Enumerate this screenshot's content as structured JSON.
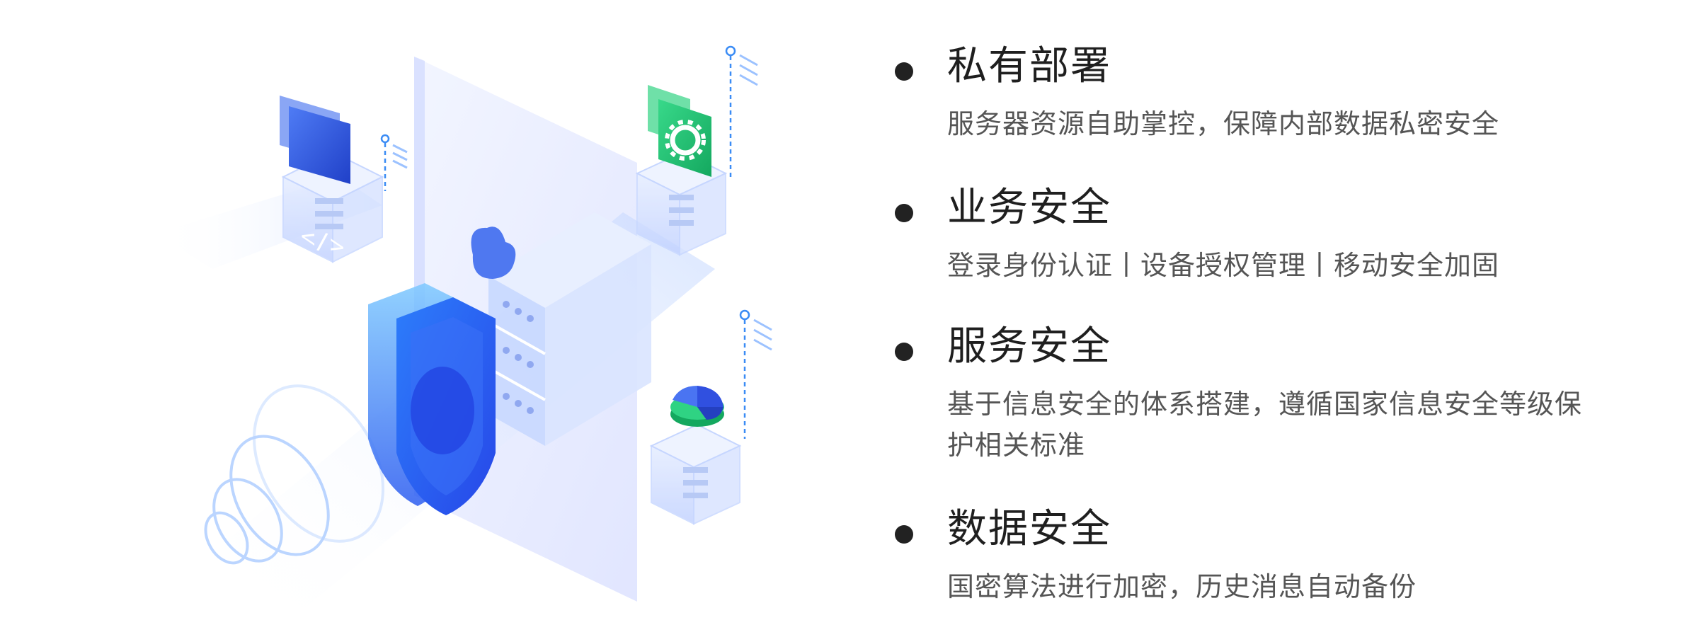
{
  "features": [
    {
      "title": "私有部署",
      "desc": "服务器资源自助掌控，保障内部数据私密安全"
    },
    {
      "title": "业务安全",
      "desc": "登录身份认证丨设备授权管理丨移动安全加固"
    },
    {
      "title": "服务安全",
      "desc": "基于信息安全的体系搭建，遵循国家信息安全等级保护相关标准"
    },
    {
      "title": "数据安全",
      "desc": "国密算法进行加密，历史消息自动备份"
    }
  ],
  "colors": {
    "shield": "#3f6ff2",
    "shield_light": "#8fd0ff",
    "gear_card": "#1fc072",
    "code_card": "#2f5ce8",
    "glass": "#dfe8ff",
    "bullet": "#222222"
  },
  "icons": {
    "code": "code-icon",
    "gear": "gear-icon",
    "pie": "pie-chart-icon",
    "cloud": "cloud-icon",
    "shield": "shield-icon"
  }
}
